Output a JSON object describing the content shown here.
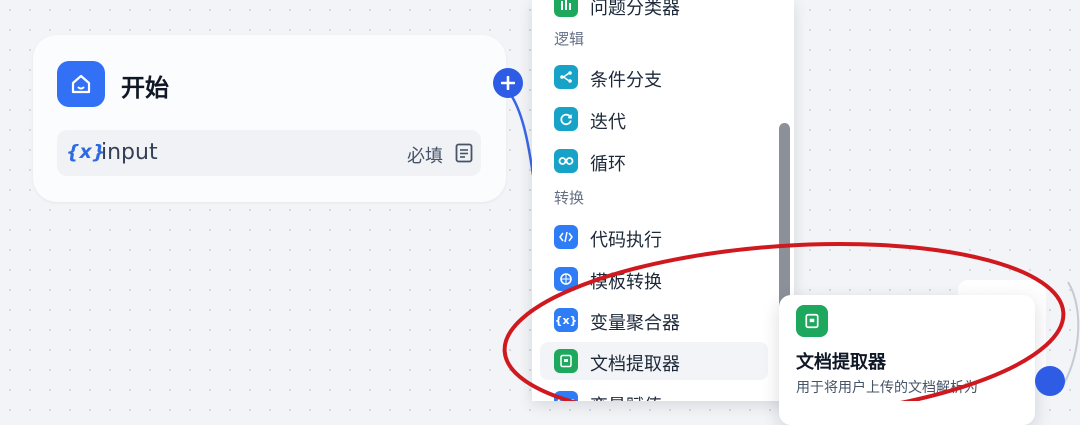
{
  "start_node": {
    "title": "开始",
    "variable": {
      "icon_text": "{x}",
      "name": "input",
      "required_label": "必填"
    }
  },
  "menu": {
    "items": [
      {
        "label": "问题分类器",
        "icon": "question-classifier-icon",
        "color": "#1ea85d"
      },
      {
        "label": "条件分支",
        "icon": "branch-icon",
        "color": "#17a2c7"
      },
      {
        "label": "迭代",
        "icon": "iteration-icon",
        "color": "#17a2c7"
      },
      {
        "label": "循环",
        "icon": "loop-icon",
        "color": "#17a2c7"
      },
      {
        "label": "代码执行",
        "icon": "code-icon",
        "color": "#2e7cf6"
      },
      {
        "label": "模板转换",
        "icon": "template-icon",
        "color": "#2e7cf6"
      },
      {
        "label": "变量聚合器",
        "icon": "variable-aggregator-icon",
        "color": "#2e7cf6"
      },
      {
        "label": "文档提取器",
        "icon": "document-extractor-icon",
        "color": "#1ea85d"
      },
      {
        "label": "变量赋值",
        "icon": "variable-assigner-icon",
        "color": "#2e7cf6"
      }
    ],
    "groups": [
      {
        "label": "逻辑"
      },
      {
        "label": "转换"
      }
    ]
  },
  "tooltip": {
    "title": "文档提取器",
    "description": "用于将用户上传的文档解析为"
  },
  "colors": {
    "accent": "#2e5ce5",
    "annotation": "#d0191f"
  }
}
